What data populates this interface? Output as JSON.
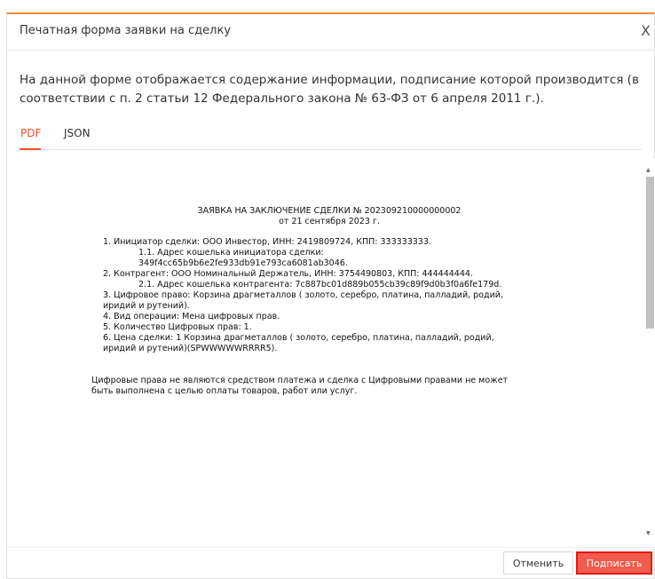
{
  "modal": {
    "title": "Печатная форма заявки на сделку",
    "close_label": "X",
    "intro_line1": "На данной форме отображается содержание информации, подписание которой производится (в",
    "intro_line2": "соответствии с п. 2 статьи 12 Федерального закона № 63-ФЗ от 6 апреля 2011 г.).",
    "tabs": [
      {
        "label": "PDF",
        "active": true
      },
      {
        "label": "JSON",
        "active": false
      }
    ],
    "document": {
      "title_line1": "ЗАЯВКА НА ЗАКЛЮЧЕНИЕ СДЕЛКИ № 202309210000000002",
      "title_line2": "от 21 сентября 2023 г.",
      "lines": [
        "1. Инициатор сделки: ООО Инвестор, ИНН: 2419809724, КПП: 333333333.",
        "1.1. Адрес кошелька инициатора сделки:",
        "349f4cc65b9b6e2fe933db91e793ca6081ab3046.",
        "2. Контрагент: ООО Номинальный Держатель, ИНН: 3754490803, КПП: 444444444.",
        "2.1. Адрес кошелька контрагента: 7c887bc01d889b055cb39c89f9d0b3f0a6fe179d.",
        "3. Цифровое право: Корзина драгметаллов ( золото, серебро, платина, палладий, родий,",
        "иридий и рутений).",
        "4. Вид операции: Мена цифровых прав.",
        "5. Количество Цифровых прав: 1.",
        "6. Цена сделки: 1 Корзина драгметаллов ( золото, серебро, платина, палладий, родий,",
        "иридий и рутений)(SPWWWWWRRRR5)."
      ],
      "disclaimer_line1": "Цифровые права не являются средством платежа и сделка с Цифровыми правами не может",
      "disclaimer_line2": "быть выполнена с целью оплаты товаров, работ или услуг."
    },
    "buttons": {
      "cancel": "Отменить",
      "sign": "Подписать"
    },
    "colors": {
      "accent": "#f04e23",
      "sign_button": "#f25c4c",
      "header_border": "#f08a3c"
    }
  }
}
